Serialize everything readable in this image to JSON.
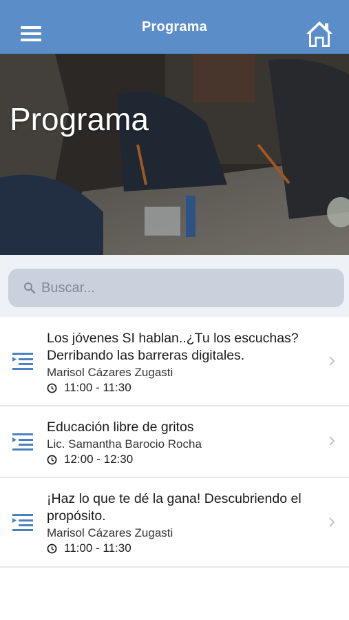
{
  "navbar": {
    "title": "Programa",
    "menu_icon": "hamburger-menu-icon",
    "home_icon": "home-icon",
    "background": "#5b8ec8"
  },
  "hero": {
    "title": "Programa"
  },
  "search": {
    "placeholder": "Buscar...",
    "value": "",
    "icon": "search-icon"
  },
  "sessions": [
    {
      "title": "Los jóvenes SI hablan..¿Tu los escuchas? Derribando las barreras digitales.",
      "speaker": "Marisol Cázares Zugasti",
      "time": "11:00 - 11:30"
    },
    {
      "title": "Educación libre de gritos",
      "speaker": "Lic. Samantha Barocio Rocha",
      "time": "12:00 - 12:30"
    },
    {
      "title": " ¡Haz lo que te dé la gana! Descubriendo el propósito.",
      "speaker": "Marisol Cázares Zugasti",
      "time": "11:00 - 11:30"
    }
  ],
  "colors": {
    "accent": "#5b8ec8",
    "list_icon": "#4a7fc0"
  }
}
